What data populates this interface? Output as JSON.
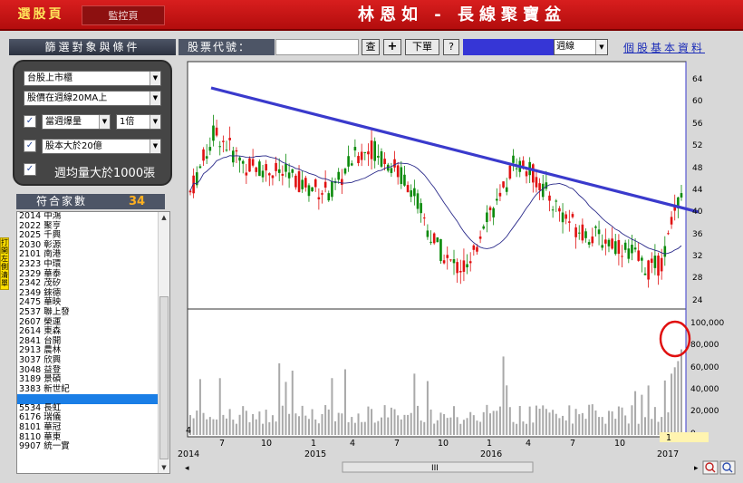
{
  "header": {
    "tab_select": "選股頁",
    "tab_monitor": "監控頁",
    "title": "林恩如 - 長線聚寶盆"
  },
  "filters": {
    "section_title": "篩選對象與條件",
    "market": "台股上市櫃",
    "price_condition": "股價在週線20MA上",
    "volume_condition": "當週爆量",
    "volume_multiple": "1倍",
    "capital_condition": "股本大於20億",
    "weekly_volume_condition": "週均量大於1000張",
    "checks": [
      "✓",
      "✓",
      "✓"
    ]
  },
  "match": {
    "label": "符合家數",
    "count": "34"
  },
  "side_tab": "打開左側清單",
  "stock_list": [
    {
      "text": "2014 中鴻"
    },
    {
      "text": "2022 聚亨"
    },
    {
      "text": "2025 千興"
    },
    {
      "text": "2030 彰源"
    },
    {
      "text": "2101 南港"
    },
    {
      "text": "2323 中環"
    },
    {
      "text": "2329 華泰"
    },
    {
      "text": "2342 茂矽"
    },
    {
      "text": "2349 錸德"
    },
    {
      "text": "2475 華映"
    },
    {
      "text": "2537 聯上發"
    },
    {
      "text": "2607 榮運"
    },
    {
      "text": "2614 東森"
    },
    {
      "text": "2841 台開"
    },
    {
      "text": "2913 農林"
    },
    {
      "text": "3037 欣興"
    },
    {
      "text": "3048 益登"
    },
    {
      "text": "3189 景碩"
    },
    {
      "text": "3383 新世紀"
    },
    {
      "text": "",
      "selected": true
    },
    {
      "text": "5534 長虹"
    },
    {
      "text": "6176 瑞儀"
    },
    {
      "text": "8101 華冠"
    },
    {
      "text": "8110 華東"
    },
    {
      "text": "9907 統一實"
    }
  ],
  "toolbar": {
    "code_label": "股票代號：",
    "code_value": "",
    "search_button": "查",
    "add_button": "+",
    "order_button": "下單",
    "help_button": "?",
    "period": "週線",
    "basic_info_link": "個股基本資料"
  },
  "chart": {
    "price_axis": [
      "64",
      "60",
      "56",
      "52",
      "48",
      "44",
      "40",
      "36",
      "32",
      "28",
      "24"
    ],
    "volume_axis": [
      "100,000",
      "80,000",
      "60,000",
      "40,000",
      "20,000",
      "0"
    ],
    "x_month_ticks": [
      "4",
      "7",
      "10",
      "1",
      "4",
      "7",
      "10",
      "1",
      "4",
      "7",
      "10",
      "1"
    ],
    "x_year_ticks": [
      "2014",
      "2015",
      "2016",
      "2017"
    ],
    "scrollbar_label": "III",
    "colors": {
      "up": "#e01010",
      "down": "#0a8a0a",
      "trend": "#3a3acc",
      "ma": "#2a2a8a",
      "volume": "#a9a9a9",
      "marker": "#e01010"
    }
  }
}
